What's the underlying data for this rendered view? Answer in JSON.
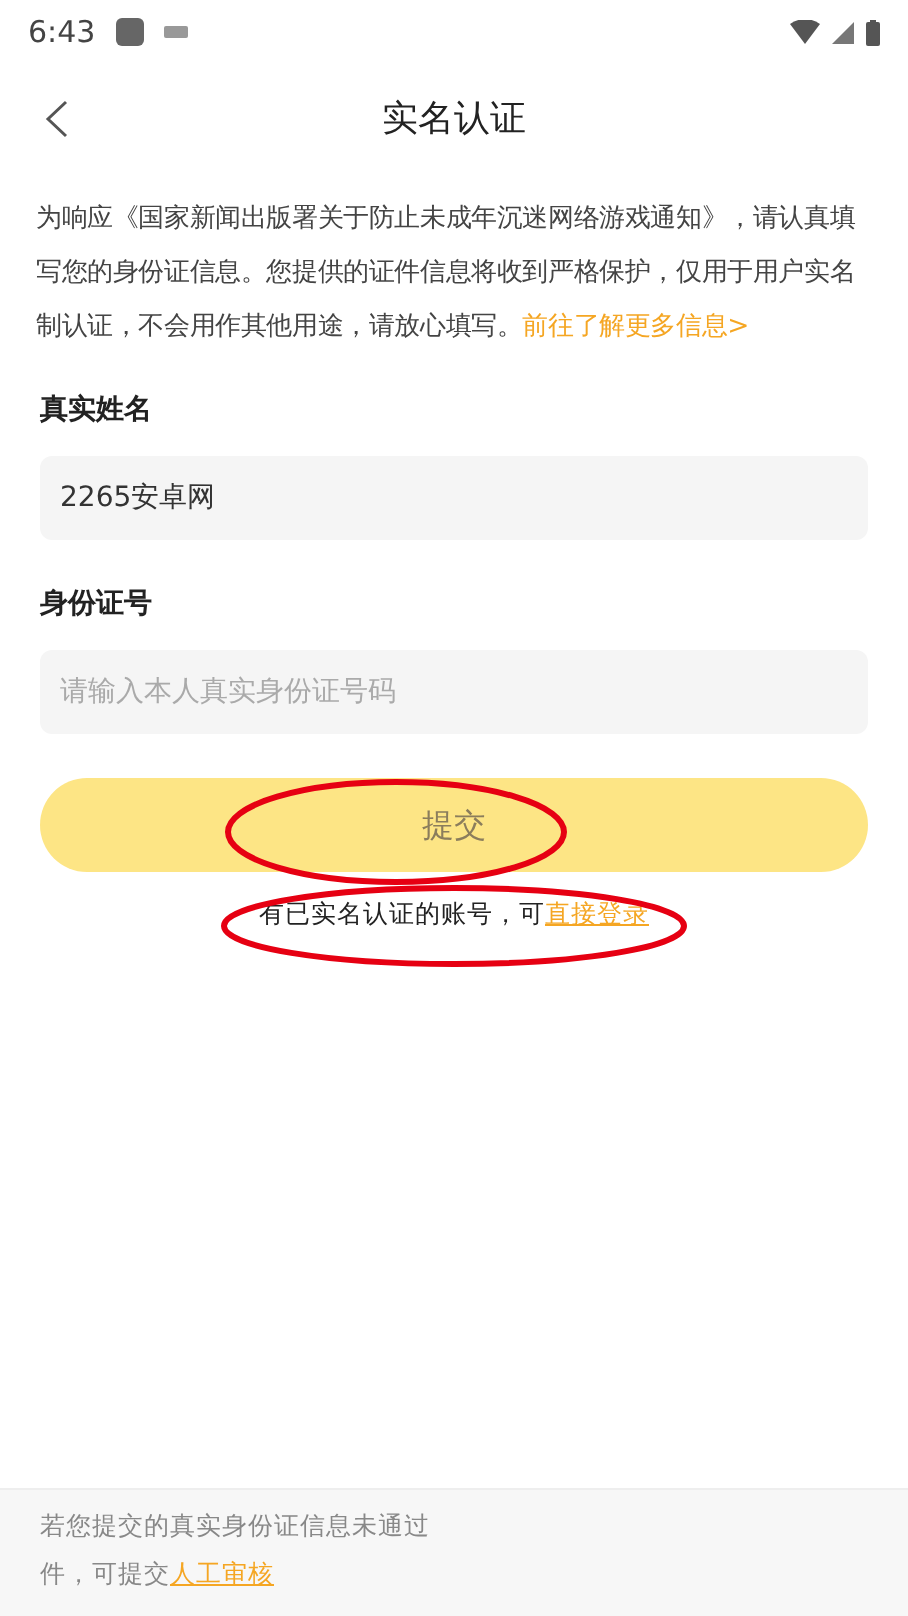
{
  "status_bar": {
    "time": "6:43"
  },
  "header": {
    "title": "实名认证"
  },
  "notice": {
    "text": "为响应《国家新闻出版署关于防止未成年沉迷网络游戏通知》，请认真填写您的身份证信息。您提供的证件信息将收到严格保护，仅用于用户实名制认证，不会用作其他用途，请放心填写。",
    "link": "前往了解更多信息>"
  },
  "fields": [
    {
      "label": "真实姓名",
      "value": "2265安卓网"
    },
    {
      "label": "身份证号",
      "placeholder": "请输入本人真实身份证号码"
    }
  ],
  "submit": {
    "label": "提交",
    "disabled": true
  },
  "login_hint": {
    "text": "有已实名认证的账号，可",
    "link": "直接登录"
  },
  "footer": {
    "line_1": "若您提交的真实身份证信息未通过",
    "line_2": "件，可提交",
    "link": "人工审核"
  }
}
